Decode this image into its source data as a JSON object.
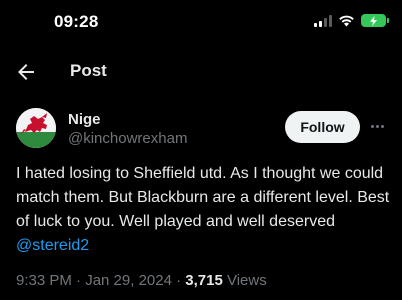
{
  "status_bar": {
    "time": "09:28",
    "icons": [
      "cellular-signal-icon",
      "wifi-icon",
      "battery-charging-icon"
    ],
    "battery_color": "#34c759"
  },
  "nav": {
    "back_icon": "arrow-left-icon",
    "title": "Post"
  },
  "post": {
    "author": {
      "name": "Nige",
      "handle": "@kinchowrexham",
      "avatar_icon": "welsh-dragon-avatar"
    },
    "follow_label": "Follow",
    "more_icon": "more-horizontal-icon",
    "text": "I hated losing to Sheffield utd. As I thought we could match them. But Blackburn are a different level. Best of luck to you. Well played and well deserved ",
    "mention": "@stereid2",
    "timestamp": "9:33 PM · Jan 29, 2024 · ",
    "views_count": "3,715",
    "views_label": " Views"
  },
  "colors": {
    "background": "#000000",
    "primary_text": "#e7e9ea",
    "secondary_text": "#71767b",
    "link": "#1d9bf0",
    "follow_button_bg": "#eff3f4"
  }
}
